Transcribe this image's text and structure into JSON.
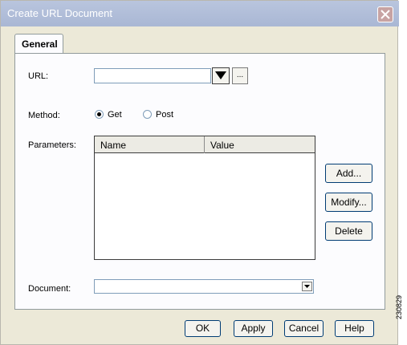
{
  "window": {
    "title": "Create URL Document",
    "close_icon": "close-icon"
  },
  "tabs": [
    {
      "label": "General"
    }
  ],
  "form": {
    "url": {
      "label": "URL:",
      "value": "",
      "browse_label": "..."
    },
    "method": {
      "label": "Method:",
      "options": [
        "Get",
        "Post"
      ],
      "selected": "Get"
    },
    "parameters": {
      "label": "Parameters:",
      "columns": [
        "Name",
        "Value"
      ],
      "rows": [],
      "buttons": {
        "add": "Add...",
        "modify": "Modify...",
        "delete": "Delete"
      }
    },
    "document": {
      "label": "Document:",
      "value": ""
    }
  },
  "footer": {
    "ok": "OK",
    "apply": "Apply",
    "cancel": "Cancel",
    "help": "Help"
  },
  "figure_id": "230829"
}
